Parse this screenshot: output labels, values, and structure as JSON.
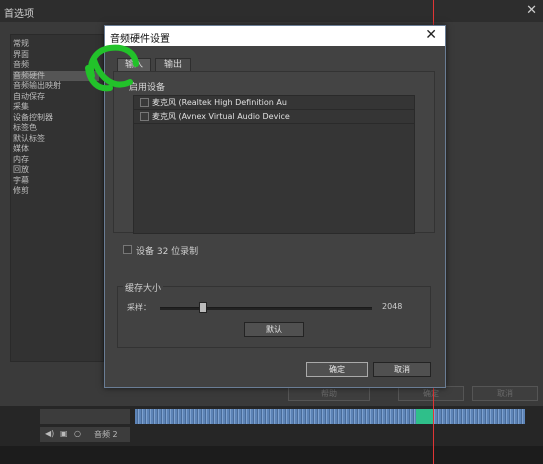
{
  "pref_window": {
    "title": "首选项",
    "close": "✕",
    "categories": [
      "常规",
      "界面",
      "音频",
      "音频硬件",
      "音频输出映射",
      "自动保存",
      "采集",
      "设备控制器",
      "标签色",
      "默认标签",
      "媒体",
      "内存",
      "回放",
      "字幕",
      "修剪"
    ],
    "selected_category": 3,
    "help_label": "帮助",
    "ok_label": "确定",
    "cancel_label": "取消"
  },
  "timeline": {
    "track2_label": "音频 2",
    "playhead_color": "#e03535"
  },
  "dialog": {
    "title": "音频硬件设置",
    "close": "✕",
    "tabs": [
      {
        "label": "输入",
        "active": true
      },
      {
        "label": "输出",
        "active": false
      }
    ],
    "device_header": "启用设备",
    "devices": [
      {
        "label": "麦克风 (Realtek High Definition Au",
        "checked": false
      },
      {
        "label": "麦克风 (Avnex Virtual Audio Device",
        "checked": false
      }
    ],
    "bit32_label": "设备 32 位录制",
    "bit32_checked": false,
    "buffer_group": "缓存大小",
    "sample_label": "采样：",
    "sample_value": "2048",
    "sample_level": 0.2,
    "default_label": "默认",
    "ok_label": "确定",
    "cancel_label": "取消"
  },
  "annotation_color": "#22c22a"
}
